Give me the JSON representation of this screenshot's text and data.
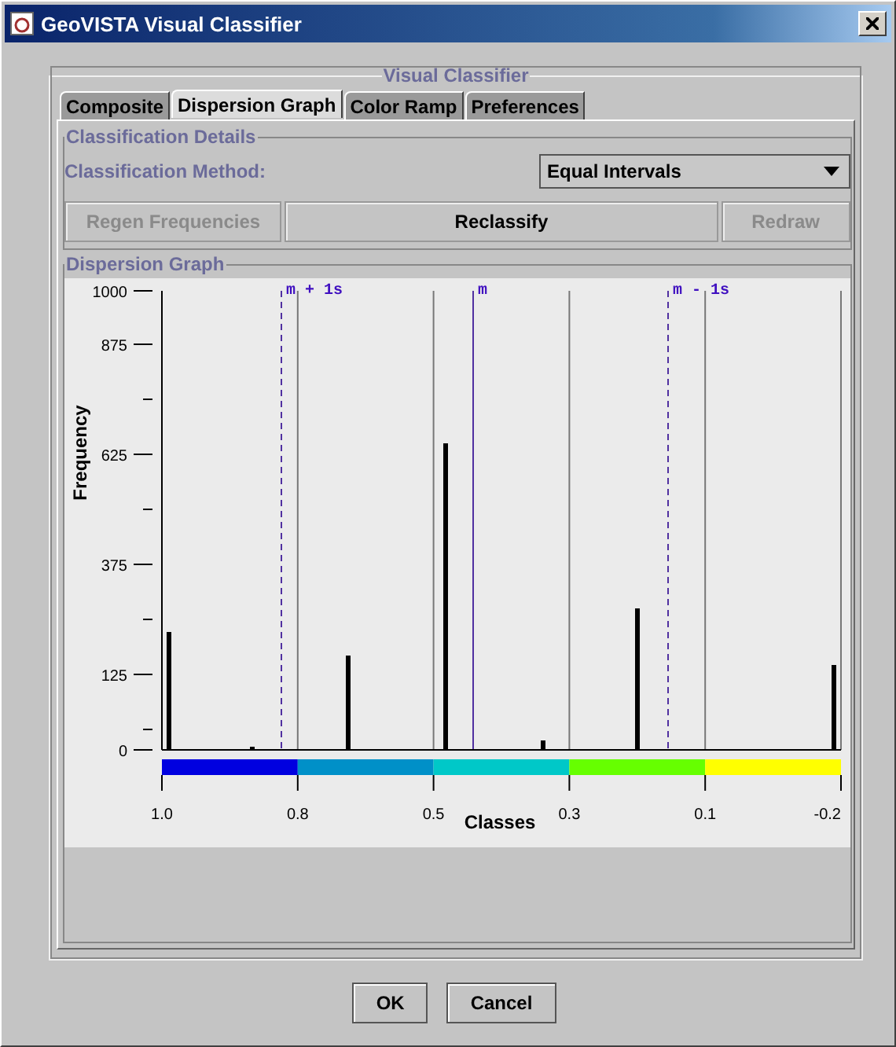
{
  "window": {
    "title": "GeoVISTA Visual Classifier"
  },
  "panel_title": "Visual Classifier",
  "tabs": [
    {
      "label": "Composite",
      "selected": false
    },
    {
      "label": "Dispersion Graph",
      "selected": true
    },
    {
      "label": "Color Ramp",
      "selected": false
    },
    {
      "label": "Preferences",
      "selected": false
    }
  ],
  "classification_details": {
    "title": "Classification Details",
    "method_label": "Classification Method:",
    "method_value": "Equal Intervals",
    "buttons": [
      {
        "label": "Regen Frequencies",
        "disabled": true
      },
      {
        "label": "Reclassify",
        "disabled": false
      },
      {
        "label": "Redraw",
        "disabled": true
      }
    ]
  },
  "dispersion_graph": {
    "title": "Dispersion Graph",
    "classes": [
      {
        "color": "#0000e0"
      },
      {
        "color": "#0090c8"
      },
      {
        "color": "#00c8c8"
      },
      {
        "color": "#66ff00"
      },
      {
        "color": "#ffff00"
      }
    ],
    "mean_lines": [
      {
        "kind": "dashed",
        "label": "m + 1s"
      },
      {
        "kind": "solid",
        "label": "m"
      },
      {
        "kind": "dashed",
        "label": "m - 1s"
      }
    ],
    "x_axis_title": "Classes",
    "y_axis_title": "Frequency",
    "x_tick_labels": [
      "1.0",
      "0.8",
      "0.5",
      "0.3",
      "0.1",
      "-0.2"
    ],
    "y_tick_labels": [
      "1000",
      "875",
      "625",
      "375",
      "125",
      "0"
    ]
  },
  "dialog_buttons": [
    "OK",
    "Cancel"
  ]
}
